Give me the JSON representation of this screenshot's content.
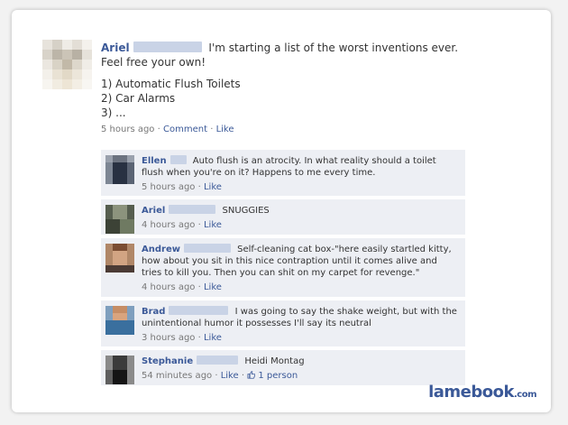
{
  "post": {
    "author": "Ariel",
    "text": "I'm starting a list of the worst inventions ever. Feel free your own!",
    "list_items": [
      "1) Automatic Flush Toilets",
      "2) Car Alarms",
      "3) ..."
    ],
    "time": "5 hours ago",
    "sep1": "·",
    "comment_label": "Comment",
    "sep2": "·",
    "like_label": "Like"
  },
  "comments": [
    {
      "author": "Ellen",
      "text": "Auto flush is an atrocity. In what reality should a toilet flush when you're on it? Happens to me every time.",
      "time": "5 hours ago",
      "like_label": "Like"
    },
    {
      "author": "Ariel",
      "text": "SNUGGIES",
      "time": "4 hours ago",
      "like_label": "Like"
    },
    {
      "author": "Andrew",
      "text": "Self-cleaning cat box-\"here easily startled kitty, how about you sit in this nice contraption until it comes alive and tries to kill you. Then you can shit on my carpet for revenge.\"",
      "time": "4 hours ago",
      "like_label": "Like"
    },
    {
      "author": "Brad",
      "text": "I was going to say the shake weight, but with the unintentional humor it possesses I'll say its neutral",
      "time": "3 hours ago",
      "like_label": "Like"
    },
    {
      "author": "Stephanie",
      "text": "Heidi Montag",
      "time": "54 minutes ago",
      "like_label": "Like",
      "likes": "1 person"
    }
  ],
  "brand": {
    "name": "lamebook",
    "suffix": ".com"
  }
}
